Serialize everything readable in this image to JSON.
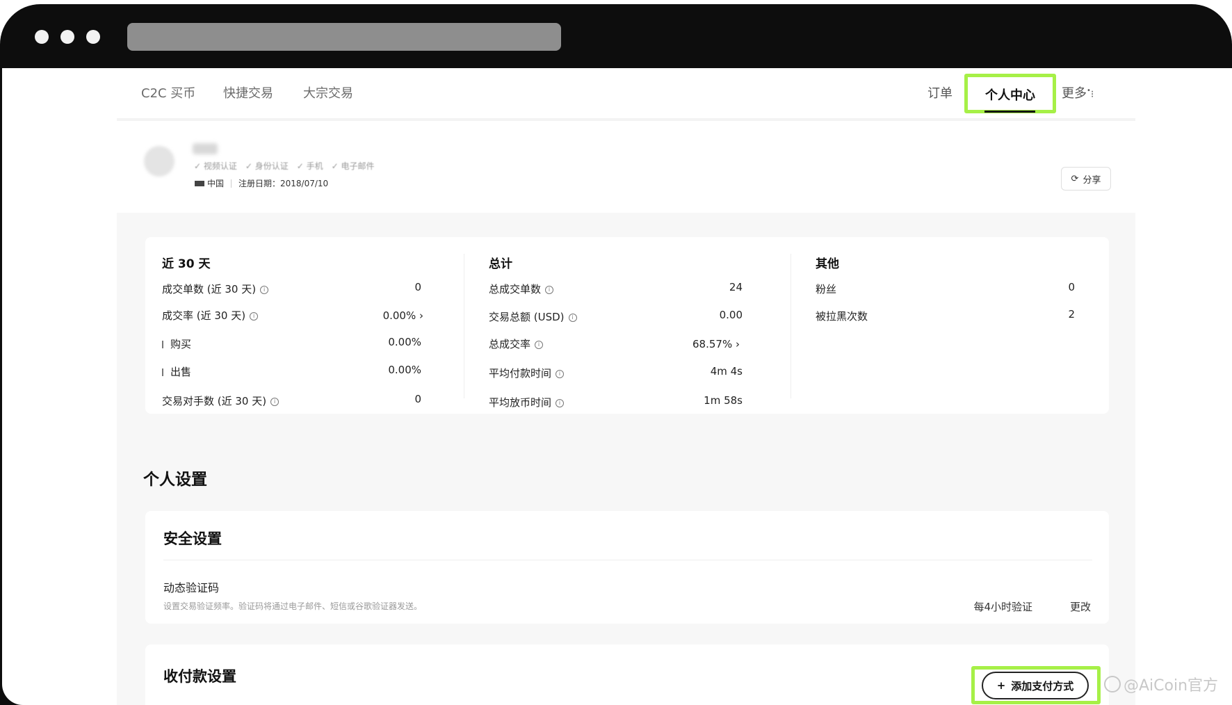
{
  "browser": {
    "window_dots": [
      "dot",
      "dot",
      "dot"
    ]
  },
  "nav": {
    "left_items": [
      "C2C 买币",
      "快捷交易",
      "大宗交易"
    ],
    "orders": "订单",
    "active": "个人中心",
    "more": "更多"
  },
  "profile": {
    "verifications": [
      "✓ 视频认证",
      "✓ 身份认证",
      "✓ 手机",
      "✓ 电子邮件"
    ],
    "country": "中国",
    "register_date": "注册日期：2018/07/10",
    "share_label": "分享"
  },
  "stats": {
    "recent": {
      "title": "近 30 天",
      "rows": [
        {
          "label": "成交单数 (近 30 天)",
          "value": "0",
          "info": true
        },
        {
          "label": "成交率 (近 30 天)",
          "value": "0.00%",
          "info": true,
          "chevron": true
        },
        {
          "label": "购买",
          "value": "0.00%",
          "bar": true
        },
        {
          "label": "出售",
          "value": "0.00%",
          "bar": true
        },
        {
          "label": "交易对手数 (近 30 天)",
          "value": "0",
          "info": true
        }
      ]
    },
    "total": {
      "title": "总计",
      "rows": [
        {
          "label": "总成交单数",
          "value": "24",
          "info": true
        },
        {
          "label": "交易总额 (USD)",
          "value": "0.00",
          "info": true
        },
        {
          "label": "总成交率",
          "value": "68.57%",
          "info": true,
          "chevron": true
        },
        {
          "label": "平均付款时间",
          "value": "4m 4s",
          "info": true
        },
        {
          "label": "平均放币时间",
          "value": "1m 58s",
          "info": true
        }
      ]
    },
    "other": {
      "title": "其他",
      "rows": [
        {
          "label": "粉丝",
          "value": "0"
        },
        {
          "label": "被拉黑次数",
          "value": "2"
        }
      ]
    }
  },
  "settings": {
    "title": "个人设置",
    "security": {
      "title": "安全设置",
      "item_title": "动态验证码",
      "item_desc": "设置交易验证频率。验证码将通过电子邮件、短信或谷歌验证器发送。",
      "value": "每4小时验证",
      "change": "更改"
    },
    "payment": {
      "title": "收付款设置",
      "add_label": "添加支付方式"
    }
  },
  "watermark": "@AiCoin官方"
}
